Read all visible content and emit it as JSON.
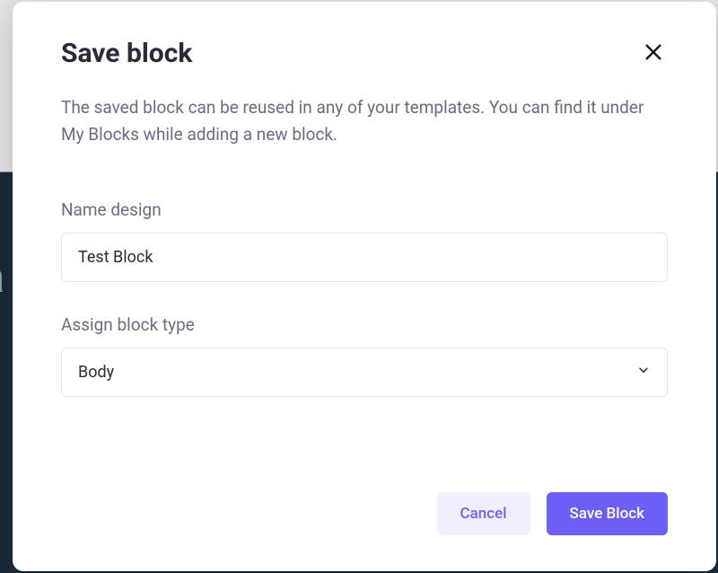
{
  "modal": {
    "title": "Save block",
    "description": "The saved block can be reused in any of your templates. You can find it under My Blocks while adding a new block.",
    "fields": {
      "name": {
        "label": "Name design",
        "value": "Test Block"
      },
      "type": {
        "label": "Assign block type",
        "value": "Body"
      }
    },
    "buttons": {
      "cancel": "Cancel",
      "save": "Save Block"
    }
  }
}
